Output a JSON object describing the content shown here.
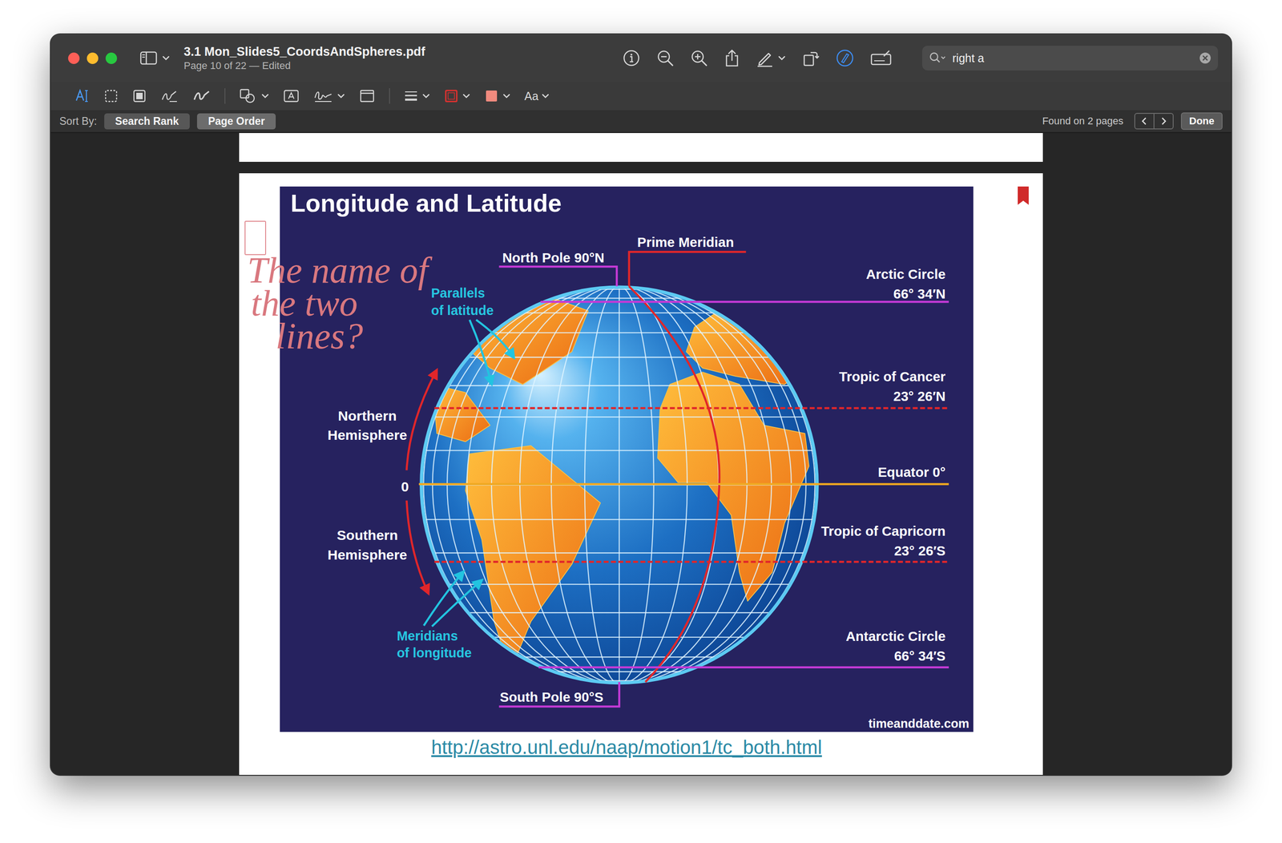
{
  "window": {
    "title": "3.1 Mon_Slides5_CoordsAndSpheres.pdf",
    "subtitle": "Page 10 of 22 — Edited"
  },
  "search": {
    "value": "right a"
  },
  "markup_toolbar": {
    "font_button": "Aa"
  },
  "find_bar": {
    "label": "Sort By:",
    "sort_options": [
      {
        "label": "Search Rank",
        "selected": false
      },
      {
        "label": "Page Order",
        "selected": true
      }
    ],
    "result": "Found on 2 pages",
    "done": "Done"
  },
  "page": {
    "bookmarked": true,
    "annotation": {
      "lines": [
        "The name of",
        "the two",
        "lines?"
      ]
    },
    "figure": {
      "title": "Longitude and Latitude",
      "prime_meridian": "Prime Meridian",
      "north_pole": "North Pole 90°N",
      "south_pole": "South Pole 90°S",
      "parallels": [
        "Parallels",
        "of latitude"
      ],
      "meridians": [
        "Meridians",
        "of longitude"
      ],
      "northern": [
        "Northern",
        "Hemisphere"
      ],
      "southern": [
        "Southern",
        "Hemisphere"
      ],
      "zero": "0",
      "circles": [
        {
          "name": "Arctic Circle",
          "value": "66° 34′N",
          "color": "#c43ad6"
        },
        {
          "name": "Tropic of Cancer",
          "value": "23° 26′N",
          "color": "#e0262a"
        },
        {
          "name": "Equator 0°",
          "value": "",
          "color": "#f0a820"
        },
        {
          "name": "Tropic of Capricorn",
          "value": "23° 26′S",
          "color": "#e0262a"
        },
        {
          "name": "Antarctic Circle",
          "value": "66° 34′S",
          "color": "#c43ad6"
        }
      ],
      "credit": "timeanddate.com"
    },
    "link": "http://astro.unl.edu/naap/motion1/tc_both.html"
  }
}
